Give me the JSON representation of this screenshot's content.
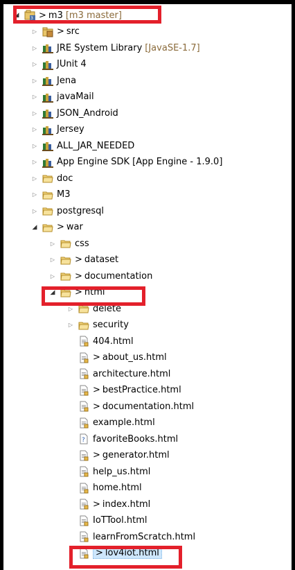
{
  "project": {
    "name": "m3",
    "decoration": "[m3 master]",
    "prefix": ">"
  },
  "items": [
    {
      "label": "src",
      "prefix": ">",
      "icon": "package-folder-icon"
    },
    {
      "label": "JRE System Library",
      "decoration": "[JavaSE-1.7]",
      "icon": "library-icon"
    },
    {
      "label": "JUnit 4",
      "icon": "library-icon"
    },
    {
      "label": "Jena",
      "icon": "library-icon"
    },
    {
      "label": "javaMail",
      "icon": "library-icon"
    },
    {
      "label": "JSON_Android",
      "icon": "library-icon"
    },
    {
      "label": "Jersey",
      "icon": "library-icon"
    },
    {
      "label": "ALL_JAR_NEEDED",
      "icon": "library-icon"
    },
    {
      "label": "App Engine SDK [App Engine - 1.9.0]",
      "icon": "library-icon"
    },
    {
      "label": "doc",
      "icon": "folder-icon"
    },
    {
      "label": "M3",
      "icon": "folder-icon"
    },
    {
      "label": "postgresql",
      "icon": "folder-icon"
    },
    {
      "label": "war",
      "prefix": ">",
      "icon": "folder-icon"
    },
    {
      "label": "css",
      "icon": "folder-icon"
    },
    {
      "label": "dataset",
      "prefix": ">",
      "icon": "folder-icon"
    },
    {
      "label": "documentation",
      "prefix": ">",
      "icon": "folder-icon"
    },
    {
      "label": "html",
      "prefix": ">",
      "icon": "folder-icon"
    },
    {
      "label": "delete",
      "icon": "folder-icon"
    },
    {
      "label": "security",
      "icon": "folder-icon"
    },
    {
      "label": "404.html",
      "icon": "html-file-icon"
    },
    {
      "label": "about_us.html",
      "prefix": ">",
      "icon": "html-file-icon"
    },
    {
      "label": "architecture.html",
      "icon": "html-file-icon"
    },
    {
      "label": "bestPractice.html",
      "prefix": ">",
      "icon": "html-file-icon"
    },
    {
      "label": "documentation.html",
      "prefix": ">",
      "icon": "html-file-icon"
    },
    {
      "label": "example.html",
      "icon": "html-file-icon"
    },
    {
      "label": "favoriteBooks.html",
      "icon": "unknown-file-icon"
    },
    {
      "label": "generator.html",
      "prefix": ">",
      "icon": "html-file-icon"
    },
    {
      "label": "help_us.html",
      "icon": "html-file-icon"
    },
    {
      "label": "home.html",
      "icon": "html-file-icon"
    },
    {
      "label": "index.html",
      "prefix": ">",
      "icon": "html-file-icon"
    },
    {
      "label": "IoTTool.html",
      "icon": "html-file-icon"
    },
    {
      "label": "learnFromScratch.html",
      "icon": "html-file-icon"
    },
    {
      "label": "lov4iot.html",
      "prefix": ">",
      "icon": "html-file-icon"
    }
  ],
  "colors": {
    "highlight": "#e3202b",
    "decoration": "#8a6a3a",
    "selection": "#cde6fb"
  }
}
